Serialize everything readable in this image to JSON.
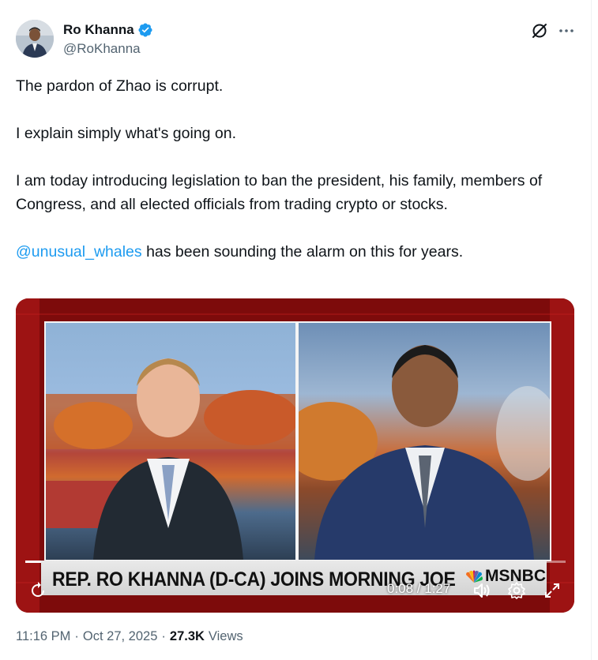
{
  "author": {
    "name": "Ro Khanna",
    "handle": "@RoKhanna",
    "verified": true,
    "avatar_icon": "avatar-photo"
  },
  "header_actions": {
    "grok_icon": "grok-icon",
    "more_icon": "more-icon"
  },
  "tweet": {
    "line1": "The pardon of Zhao is corrupt.",
    "line2": "I explain simply what's going on.",
    "line3": "I am today introducing legislation to ban the president, his family, members of Congress, and all elected officials from trading crypto or stocks.",
    "mention": "@unusual_whales",
    "line4_rest": " has been sounding the alarm on this for years."
  },
  "video": {
    "lower_third": "REP. RO KHANNA (D-CA) JOINS MORNING JOE",
    "network": "MSNBC",
    "time": "0:08 / 1:27",
    "progress": 0.09
  },
  "footer": {
    "time": "11:16 PM",
    "sep": "·",
    "date": "Oct 27, 2025",
    "sep2": "·",
    "views_count": "27.3K",
    "views_label": "Views"
  },
  "colors": {
    "link": "#1d9bf0",
    "verified": "#1d9bf0",
    "secondary_text": "#536471"
  }
}
